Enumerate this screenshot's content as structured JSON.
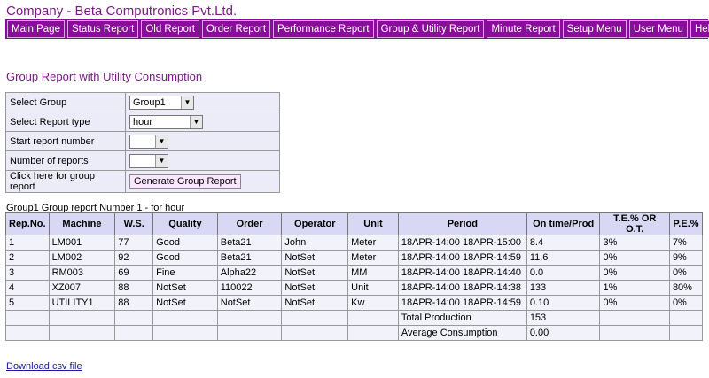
{
  "company": "Company - Beta Computronics Pvt.Ltd.",
  "nav": [
    "Main Page",
    "Status Report",
    "Old Report",
    "Order Report",
    "Performance Report",
    "Group & Utility Report",
    "Minute Report",
    "Setup Menu",
    "User Menu",
    "Help"
  ],
  "page_title": "Group Report with Utility Consumption",
  "form": {
    "select_group_label": "Select Group",
    "select_group_value": "Group1",
    "report_type_label": "Select Report type",
    "report_type_value": "hour",
    "start_number_label": "Start report number",
    "start_number_value": "",
    "num_reports_label": "Number of reports",
    "num_reports_value": "",
    "generate_label": "Click here for group report",
    "generate_button": "Generate Group Report"
  },
  "report_caption": "Group1 Group report Number 1 - for hour",
  "table": {
    "headers": [
      "Rep.No.",
      "Machine",
      "W.S.",
      "Quality",
      "Order",
      "Operator",
      "Unit",
      "Period",
      "On time/Prod",
      "T.E.% OR O.T.",
      "P.E.%"
    ],
    "rows": [
      [
        "1",
        "LM001",
        "77",
        "Good",
        "Beta21",
        "John",
        "Meter",
        "18APR-14:00 18APR-15:00",
        "8.4",
        "3%",
        "7%"
      ],
      [
        "2",
        "LM002",
        "92",
        "Good",
        "Beta21",
        "NotSet",
        "Meter",
        "18APR-14:00 18APR-14:59",
        "11.6",
        "0%",
        "9%"
      ],
      [
        "3",
        "RM003",
        "69",
        "Fine",
        "Alpha22",
        "NotSet",
        "MM",
        "18APR-14:00 18APR-14:40",
        "0.0",
        "0%",
        "0%"
      ],
      [
        "4",
        "XZ007",
        "88",
        "NotSet",
        "110022",
        "NotSet",
        "Unit",
        "18APR-14:00 18APR-14:38",
        "133",
        "1%",
        "80%"
      ],
      [
        "5",
        "UTILITY1",
        "88",
        "NotSet",
        "NotSet",
        "NotSet",
        "Kw",
        "18APR-14:00 18APR-14:59",
        "0.10",
        "0%",
        "0%"
      ]
    ],
    "total_label": "Total Production",
    "total_value": "153",
    "avg_label": "Average Consumption",
    "avg_value": "0.00"
  },
  "download_link": "Download csv file"
}
